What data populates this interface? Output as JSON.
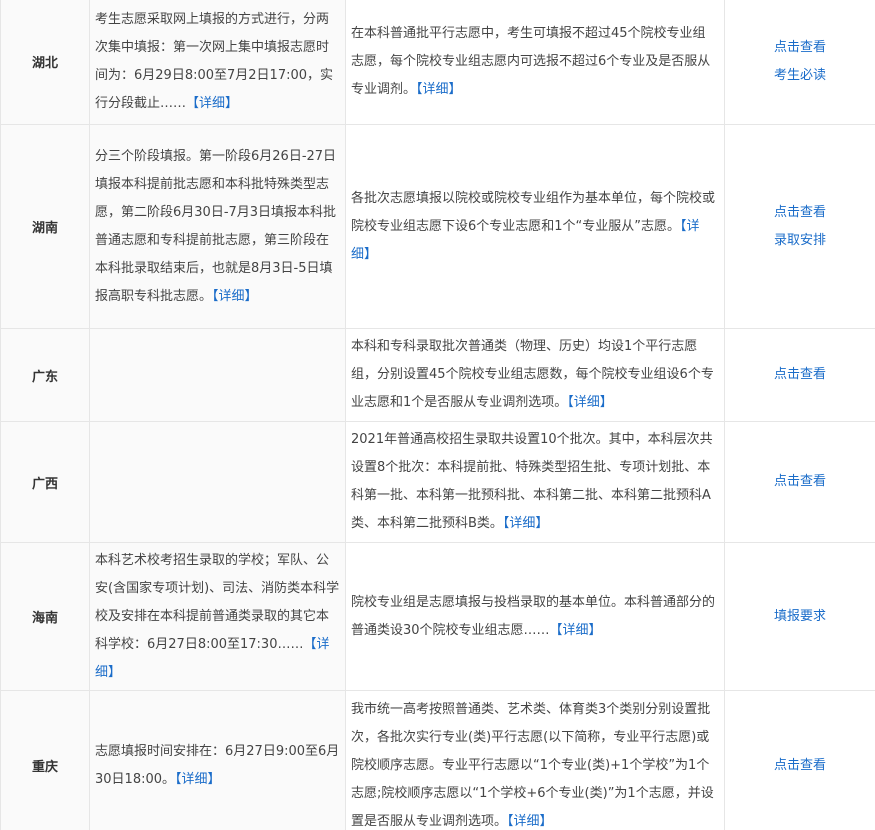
{
  "rows": [
    {
      "province": "湖北",
      "time_text": "考生志愿采取网上填报的方式进行，分两次集中填报：第一次网上集中填报志愿时间为：6月29日8:00至7月2日17:00，实行分段截止……",
      "time_detail": "【详细】",
      "rule_text": "在本科普通批平行志愿中，考生可填报不超过45个院校专业组志愿，每个院校专业组志愿内可选报不超过6个专业及是否服从专业调剂。",
      "rule_detail": "【详细】",
      "links": [
        "点击查看",
        "考生必读"
      ]
    },
    {
      "province": "湖南",
      "time_text": "分三个阶段填报。第一阶段6月26日-27日填报本科提前批志愿和本科批特殊类型志愿，第二阶段6月30日-7月3日填报本科批普通志愿和专科提前批志愿，第三阶段在本科批录取结束后，也就是8月3日-5日填报高职专科批志愿。",
      "time_detail": "【详细】",
      "rule_text": "各批次志愿填报以院校或院校专业组作为基本单位，每个院校或院校专业组志愿下设6个专业志愿和1个“专业服从”志愿。",
      "rule_detail": "【详细】",
      "links": [
        "点击查看",
        "录取安排"
      ]
    },
    {
      "province": "广东",
      "time_text": "",
      "time_detail": "",
      "rule_text": "本科和专科录取批次普通类（物理、历史）均设1个平行志愿组，分别设置45个院校专业组志愿数，每个院校专业组设6个专业志愿和1个是否服从专业调剂选项。",
      "rule_detail": "【详细】",
      "links": [
        "点击查看"
      ]
    },
    {
      "province": "广西",
      "time_text": "",
      "time_detail": "",
      "rule_text": "2021年普通高校招生录取共设置10个批次。其中，本科层次共设置8个批次：本科提前批、特殊类型招生批、专项计划批、本科第一批、本科第一批预科批、本科第二批、本科第二批预科A类、本科第二批预科B类。",
      "rule_detail": "【详细】",
      "links": [
        "点击查看"
      ]
    },
    {
      "province": "海南",
      "time_text": "本科艺术校考招生录取的学校；军队、公安(含国家专项计划)、司法、消防类本科学校及安排在本科提前普通类录取的其它本科学校：6月27日8:00至17:30……",
      "time_detail": "【详细】",
      "rule_text": "院校专业组是志愿填报与投档录取的基本单位。本科普通部分的普通类设30个院校专业组志愿……",
      "rule_detail": "【详细】",
      "links": [
        "填报要求"
      ]
    },
    {
      "province": "重庆",
      "time_text": "志愿填报时间安排在：6月27日9:00至6月30日18:00。",
      "time_detail": "【详细】",
      "rule_text": "我市统一高考按照普通类、艺术类、体育类3个类别分别设置批次，各批次实行专业(类)平行志愿(以下简称，专业平行志愿)或院校顺序志愿。专业平行志愿以“1个专业(类)+1个学校”为1个志愿;院校顺序志愿以“1个学校+6个专业(类)”为1个志愿，并设置是否服从专业调剂选项。",
      "rule_detail": "【详细】",
      "links": [
        "点击查看"
      ]
    }
  ]
}
